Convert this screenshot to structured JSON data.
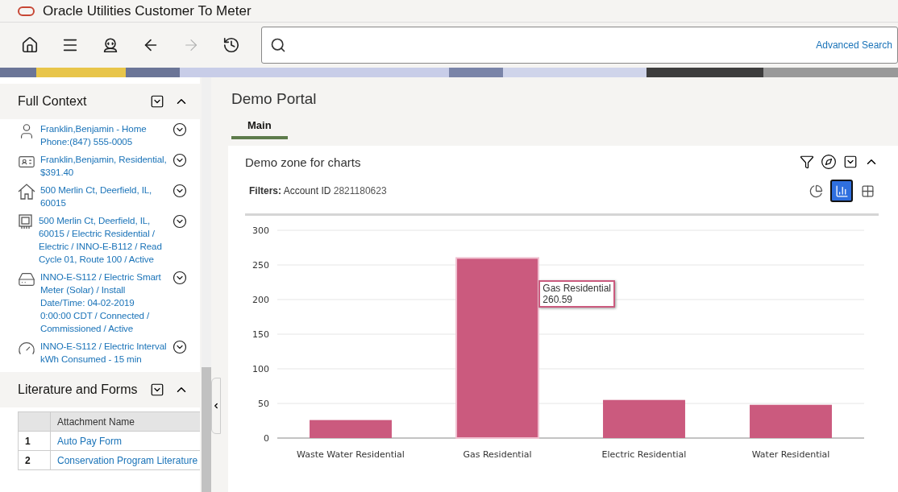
{
  "app": {
    "title": "Oracle Utilities Customer To Meter"
  },
  "toolbar": {
    "buttons": [
      {
        "kind": "home",
        "disabled": false
      },
      {
        "kind": "menu",
        "disabled": false
      },
      {
        "kind": "agent",
        "disabled": false
      },
      {
        "kind": "back",
        "disabled": false
      },
      {
        "kind": "forward",
        "disabled": true
      },
      {
        "kind": "history",
        "disabled": false
      }
    ],
    "search": {
      "link": "Advanced Search"
    }
  },
  "sidebar": {
    "sections": [
      {
        "title": "Full Context",
        "expanded": true,
        "items": [
          {
            "kind": "person",
            "text": "Franklin,Benjamin - Home Phone:(847) 555-0005"
          },
          {
            "kind": "account",
            "text": "Franklin,Benjamin, Residential, $391.40"
          },
          {
            "kind": "premise",
            "text": "500 Merlin Ct, Deerfield, IL, 60015"
          },
          {
            "kind": "service-point",
            "text": "500 Merlin Ct, Deerfield, IL, 60015 / Electric Residential / Electric / INNO-E-B112 / Read Cycle 01, Route 100 / Active"
          },
          {
            "kind": "device",
            "text": "INNO-E-S112 / Electric Smart Meter (Solar) / Install Date/Time: 04-02-2019 0:00:00 CDT / Connected / Commissioned / Active"
          },
          {
            "kind": "measuring",
            "text": "INNO-E-S112 / Electric Interval kWh Consumed - 15 min"
          }
        ]
      },
      {
        "title": "Literature and Forms",
        "expanded": true,
        "table": {
          "columns": [
            "Attachment Name"
          ],
          "rows": [
            {
              "index": "1",
              "name": "Auto Pay Form"
            },
            {
              "index": "2",
              "name": "Conservation Program Literature"
            }
          ]
        }
      }
    ]
  },
  "portal": {
    "title": "Demo Portal",
    "tabs": [
      {
        "label": "Main",
        "selected": true
      }
    ],
    "zone": {
      "title": "Demo zone for charts",
      "filters_label": "Filters:",
      "filters_text": "Account ID",
      "filters_value": "2821180623",
      "views": [
        {
          "kind": "pie",
          "selected": false
        },
        {
          "kind": "bar",
          "selected": true
        },
        {
          "kind": "table",
          "selected": false
        }
      ],
      "tooltip": {
        "label": "Gas Residential",
        "value": "260.59"
      },
      "chart_data": {
        "type": "bar",
        "categories": [
          "Waste Water Residential",
          "Gas Residential",
          "Electric Residential",
          "Water Residential"
        ],
        "series": [
          {
            "color": "#cb5a7e",
            "values": [
              26,
              260,
              55,
              48
            ]
          }
        ],
        "grid": true,
        "ylim": [
          0,
          300
        ],
        "yticks": [
          0,
          50,
          100,
          150,
          200,
          250,
          300
        ]
      }
    }
  }
}
